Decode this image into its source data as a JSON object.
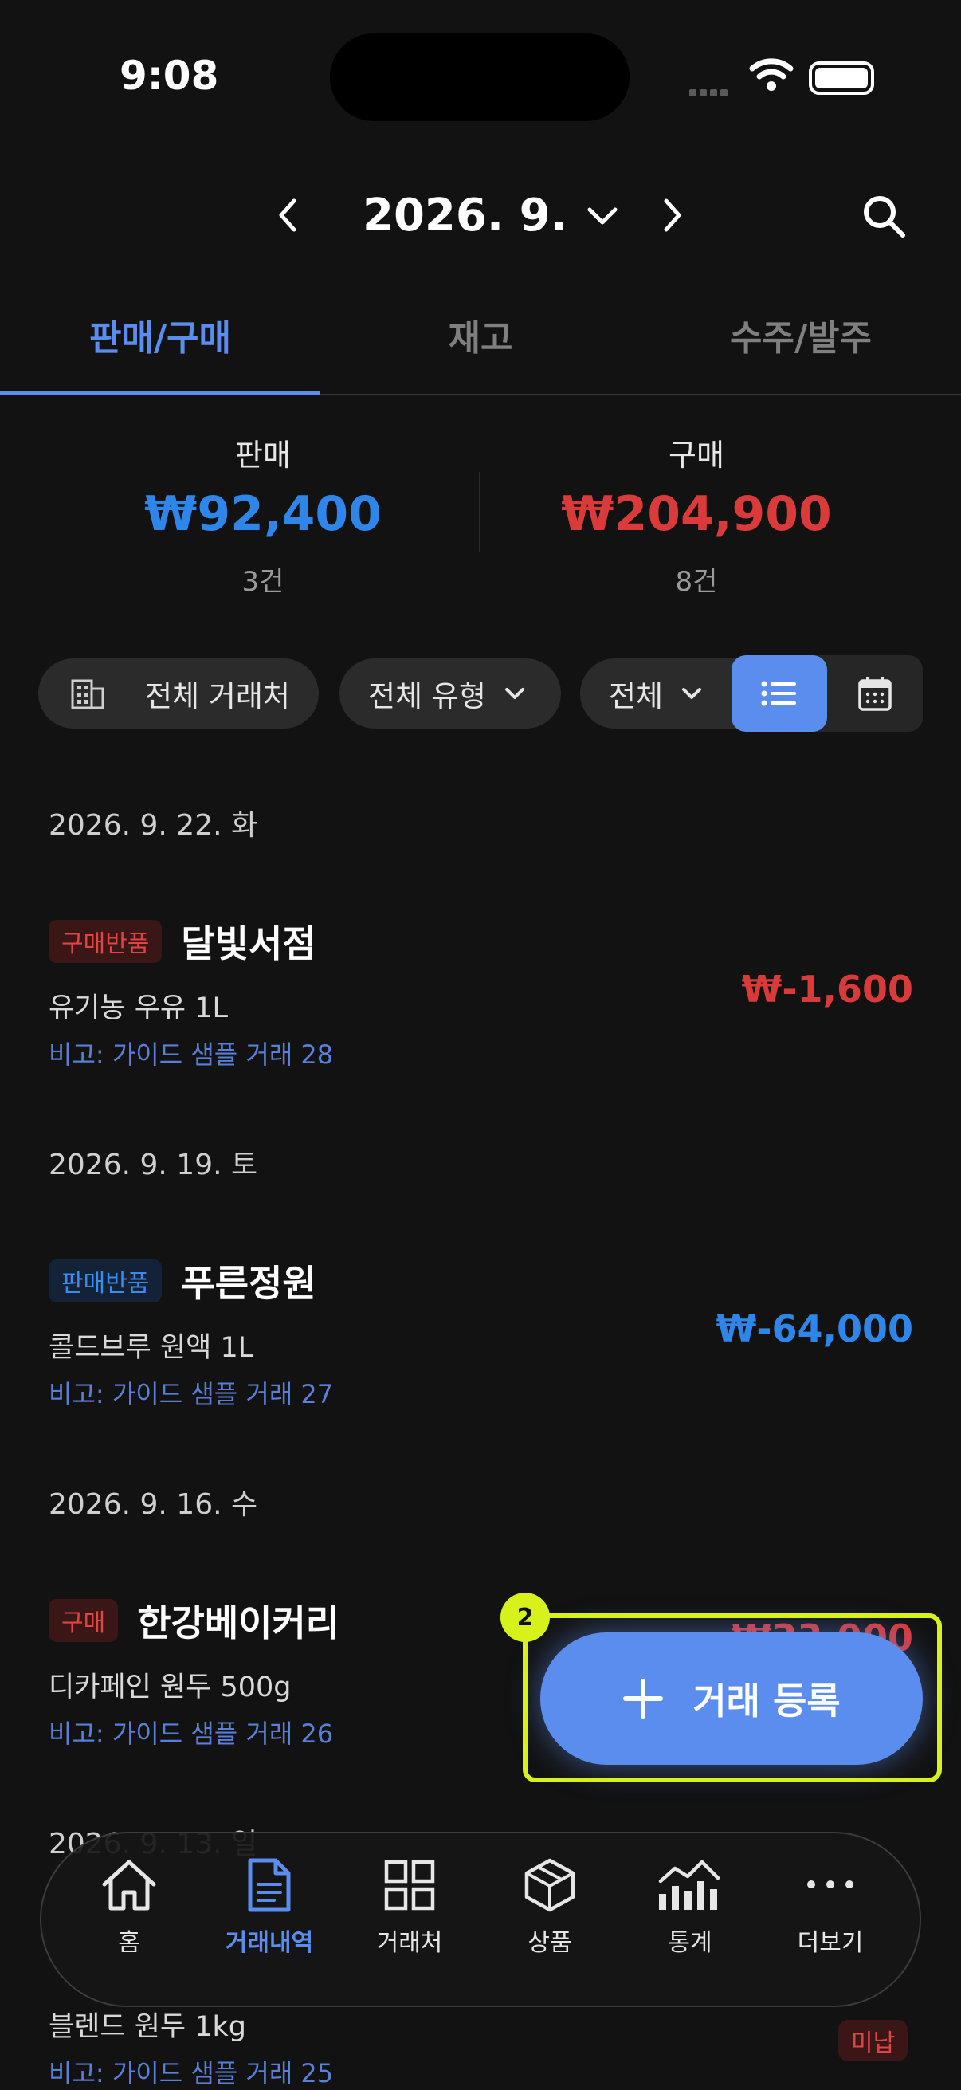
{
  "status_bar": {
    "time": "9:08"
  },
  "header": {
    "month": "2026. 9."
  },
  "tabs": [
    {
      "label": "판매/구매",
      "active": true
    },
    {
      "label": "재고",
      "active": false
    },
    {
      "label": "수주/발주",
      "active": false
    }
  ],
  "summary": {
    "sales": {
      "label": "판매",
      "amount": "₩92,400",
      "count": "3건",
      "color": "#2f86ea"
    },
    "purchase": {
      "label": "구매",
      "amount": "₩204,900",
      "count": "8건",
      "color": "#d93a3a"
    }
  },
  "filters": {
    "vendor": "전체 거래처",
    "type": "전체 유형",
    "status": "전체",
    "view_modes": [
      "list-icon",
      "calendar-icon"
    ],
    "active_view": "list"
  },
  "groups": [
    {
      "date": "2026. 9. 22. 화",
      "transactions": [
        {
          "badge": "구매반품",
          "badge_color": "red",
          "vendor": "달빛서점",
          "item": "유기농 우유 1L",
          "note": "비고: 가이드 샘플 거래 28",
          "amount": "₩-1,600",
          "amount_color": "red"
        }
      ]
    },
    {
      "date": "2026. 9. 19. 토",
      "transactions": [
        {
          "badge": "판매반품",
          "badge_color": "blue",
          "vendor": "푸른정원",
          "item": "콜드브루 원액 1L",
          "note": "비고: 가이드 샘플 거래 27",
          "amount": "₩-64,000",
          "amount_color": "blue"
        }
      ]
    },
    {
      "date": "2026. 9. 16. 수",
      "transactions": [
        {
          "badge": "구매",
          "badge_color": "red",
          "vendor": "한강베이커리",
          "item": "디카페인 원두 500g",
          "note": "비고: 가이드 샘플 거래 26",
          "amount": "₩33,000",
          "amount_color": "red"
        }
      ]
    },
    {
      "date": "2026. 9. 13. 일",
      "transactions": [
        {
          "badge": "",
          "vendor": "",
          "item": "블렌드 원두 1kg",
          "note": "비고: 가이드 샘플 거래 25",
          "status": "미납"
        }
      ]
    }
  ],
  "fab": {
    "label": "거래 등록",
    "step_number": "2",
    "icon": "plus-icon"
  },
  "bottom_nav": [
    {
      "label": "홈",
      "icon": "home-icon",
      "active": false
    },
    {
      "label": "거래내역",
      "icon": "document-icon",
      "active": true
    },
    {
      "label": "거래처",
      "icon": "grid-icon",
      "active": false
    },
    {
      "label": "상품",
      "icon": "box-icon",
      "active": false
    },
    {
      "label": "통계",
      "icon": "chart-icon",
      "active": false
    },
    {
      "label": "더보기",
      "icon": "more-icon",
      "active": false
    }
  ],
  "colors": {
    "accent": "#5b8def",
    "highlight": "#d7f21a",
    "sale": "#2f86ea",
    "purchase": "#d93a3a"
  }
}
